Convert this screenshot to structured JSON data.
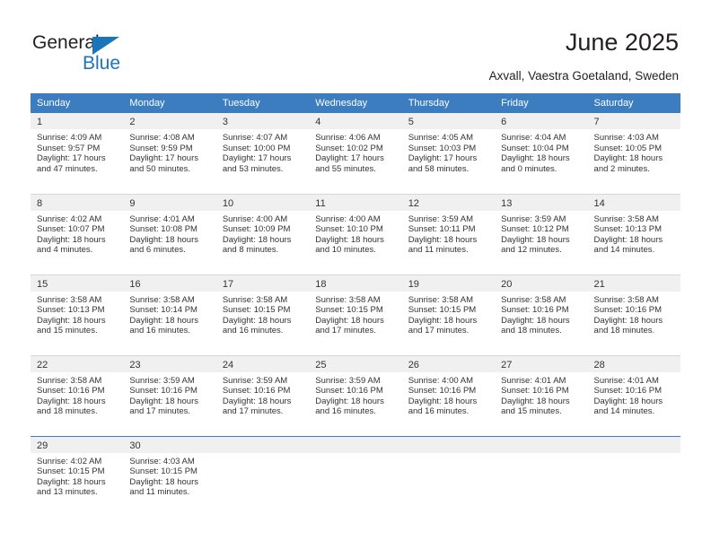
{
  "branding": {
    "logo_primary": "General",
    "logo_secondary": "Blue",
    "logo_icon": "blue-triangle"
  },
  "header": {
    "title": "June 2025",
    "subtitle": "Axvall, Vaestra Goetaland, Sweden"
  },
  "colors": {
    "header_blue": "#3b7dbf",
    "logo_blue": "#1b75bb",
    "day_number_bg": "#f0f0f0",
    "text": "#333333"
  },
  "calendar": {
    "weekday_headers": [
      "Sunday",
      "Monday",
      "Tuesday",
      "Wednesday",
      "Thursday",
      "Friday",
      "Saturday"
    ],
    "weeks": [
      [
        {
          "day": "1",
          "sunrise": "Sunrise: 4:09 AM",
          "sunset": "Sunset: 9:57 PM",
          "daylight1": "Daylight: 17 hours",
          "daylight2": "and 47 minutes."
        },
        {
          "day": "2",
          "sunrise": "Sunrise: 4:08 AM",
          "sunset": "Sunset: 9:59 PM",
          "daylight1": "Daylight: 17 hours",
          "daylight2": "and 50 minutes."
        },
        {
          "day": "3",
          "sunrise": "Sunrise: 4:07 AM",
          "sunset": "Sunset: 10:00 PM",
          "daylight1": "Daylight: 17 hours",
          "daylight2": "and 53 minutes."
        },
        {
          "day": "4",
          "sunrise": "Sunrise: 4:06 AM",
          "sunset": "Sunset: 10:02 PM",
          "daylight1": "Daylight: 17 hours",
          "daylight2": "and 55 minutes."
        },
        {
          "day": "5",
          "sunrise": "Sunrise: 4:05 AM",
          "sunset": "Sunset: 10:03 PM",
          "daylight1": "Daylight: 17 hours",
          "daylight2": "and 58 minutes."
        },
        {
          "day": "6",
          "sunrise": "Sunrise: 4:04 AM",
          "sunset": "Sunset: 10:04 PM",
          "daylight1": "Daylight: 18 hours",
          "daylight2": "and 0 minutes."
        },
        {
          "day": "7",
          "sunrise": "Sunrise: 4:03 AM",
          "sunset": "Sunset: 10:05 PM",
          "daylight1": "Daylight: 18 hours",
          "daylight2": "and 2 minutes."
        }
      ],
      [
        {
          "day": "8",
          "sunrise": "Sunrise: 4:02 AM",
          "sunset": "Sunset: 10:07 PM",
          "daylight1": "Daylight: 18 hours",
          "daylight2": "and 4 minutes."
        },
        {
          "day": "9",
          "sunrise": "Sunrise: 4:01 AM",
          "sunset": "Sunset: 10:08 PM",
          "daylight1": "Daylight: 18 hours",
          "daylight2": "and 6 minutes."
        },
        {
          "day": "10",
          "sunrise": "Sunrise: 4:00 AM",
          "sunset": "Sunset: 10:09 PM",
          "daylight1": "Daylight: 18 hours",
          "daylight2": "and 8 minutes."
        },
        {
          "day": "11",
          "sunrise": "Sunrise: 4:00 AM",
          "sunset": "Sunset: 10:10 PM",
          "daylight1": "Daylight: 18 hours",
          "daylight2": "and 10 minutes."
        },
        {
          "day": "12",
          "sunrise": "Sunrise: 3:59 AM",
          "sunset": "Sunset: 10:11 PM",
          "daylight1": "Daylight: 18 hours",
          "daylight2": "and 11 minutes."
        },
        {
          "day": "13",
          "sunrise": "Sunrise: 3:59 AM",
          "sunset": "Sunset: 10:12 PM",
          "daylight1": "Daylight: 18 hours",
          "daylight2": "and 12 minutes."
        },
        {
          "day": "14",
          "sunrise": "Sunrise: 3:58 AM",
          "sunset": "Sunset: 10:13 PM",
          "daylight1": "Daylight: 18 hours",
          "daylight2": "and 14 minutes."
        }
      ],
      [
        {
          "day": "15",
          "sunrise": "Sunrise: 3:58 AM",
          "sunset": "Sunset: 10:13 PM",
          "daylight1": "Daylight: 18 hours",
          "daylight2": "and 15 minutes."
        },
        {
          "day": "16",
          "sunrise": "Sunrise: 3:58 AM",
          "sunset": "Sunset: 10:14 PM",
          "daylight1": "Daylight: 18 hours",
          "daylight2": "and 16 minutes."
        },
        {
          "day": "17",
          "sunrise": "Sunrise: 3:58 AM",
          "sunset": "Sunset: 10:15 PM",
          "daylight1": "Daylight: 18 hours",
          "daylight2": "and 16 minutes."
        },
        {
          "day": "18",
          "sunrise": "Sunrise: 3:58 AM",
          "sunset": "Sunset: 10:15 PM",
          "daylight1": "Daylight: 18 hours",
          "daylight2": "and 17 minutes."
        },
        {
          "day": "19",
          "sunrise": "Sunrise: 3:58 AM",
          "sunset": "Sunset: 10:15 PM",
          "daylight1": "Daylight: 18 hours",
          "daylight2": "and 17 minutes."
        },
        {
          "day": "20",
          "sunrise": "Sunrise: 3:58 AM",
          "sunset": "Sunset: 10:16 PM",
          "daylight1": "Daylight: 18 hours",
          "daylight2": "and 18 minutes."
        },
        {
          "day": "21",
          "sunrise": "Sunrise: 3:58 AM",
          "sunset": "Sunset: 10:16 PM",
          "daylight1": "Daylight: 18 hours",
          "daylight2": "and 18 minutes."
        }
      ],
      [
        {
          "day": "22",
          "sunrise": "Sunrise: 3:58 AM",
          "sunset": "Sunset: 10:16 PM",
          "daylight1": "Daylight: 18 hours",
          "daylight2": "and 18 minutes."
        },
        {
          "day": "23",
          "sunrise": "Sunrise: 3:59 AM",
          "sunset": "Sunset: 10:16 PM",
          "daylight1": "Daylight: 18 hours",
          "daylight2": "and 17 minutes."
        },
        {
          "day": "24",
          "sunrise": "Sunrise: 3:59 AM",
          "sunset": "Sunset: 10:16 PM",
          "daylight1": "Daylight: 18 hours",
          "daylight2": "and 17 minutes."
        },
        {
          "day": "25",
          "sunrise": "Sunrise: 3:59 AM",
          "sunset": "Sunset: 10:16 PM",
          "daylight1": "Daylight: 18 hours",
          "daylight2": "and 16 minutes."
        },
        {
          "day": "26",
          "sunrise": "Sunrise: 4:00 AM",
          "sunset": "Sunset: 10:16 PM",
          "daylight1": "Daylight: 18 hours",
          "daylight2": "and 16 minutes."
        },
        {
          "day": "27",
          "sunrise": "Sunrise: 4:01 AM",
          "sunset": "Sunset: 10:16 PM",
          "daylight1": "Daylight: 18 hours",
          "daylight2": "and 15 minutes."
        },
        {
          "day": "28",
          "sunrise": "Sunrise: 4:01 AM",
          "sunset": "Sunset: 10:16 PM",
          "daylight1": "Daylight: 18 hours",
          "daylight2": "and 14 minutes."
        }
      ],
      [
        {
          "day": "29",
          "sunrise": "Sunrise: 4:02 AM",
          "sunset": "Sunset: 10:15 PM",
          "daylight1": "Daylight: 18 hours",
          "daylight2": "and 13 minutes."
        },
        {
          "day": "30",
          "sunrise": "Sunrise: 4:03 AM",
          "sunset": "Sunset: 10:15 PM",
          "daylight1": "Daylight: 18 hours",
          "daylight2": "and 11 minutes."
        },
        {
          "day": "",
          "sunrise": "",
          "sunset": "",
          "daylight1": "",
          "daylight2": ""
        },
        {
          "day": "",
          "sunrise": "",
          "sunset": "",
          "daylight1": "",
          "daylight2": ""
        },
        {
          "day": "",
          "sunrise": "",
          "sunset": "",
          "daylight1": "",
          "daylight2": ""
        },
        {
          "day": "",
          "sunrise": "",
          "sunset": "",
          "daylight1": "",
          "daylight2": ""
        },
        {
          "day": "",
          "sunrise": "",
          "sunset": "",
          "daylight1": "",
          "daylight2": ""
        }
      ]
    ]
  }
}
